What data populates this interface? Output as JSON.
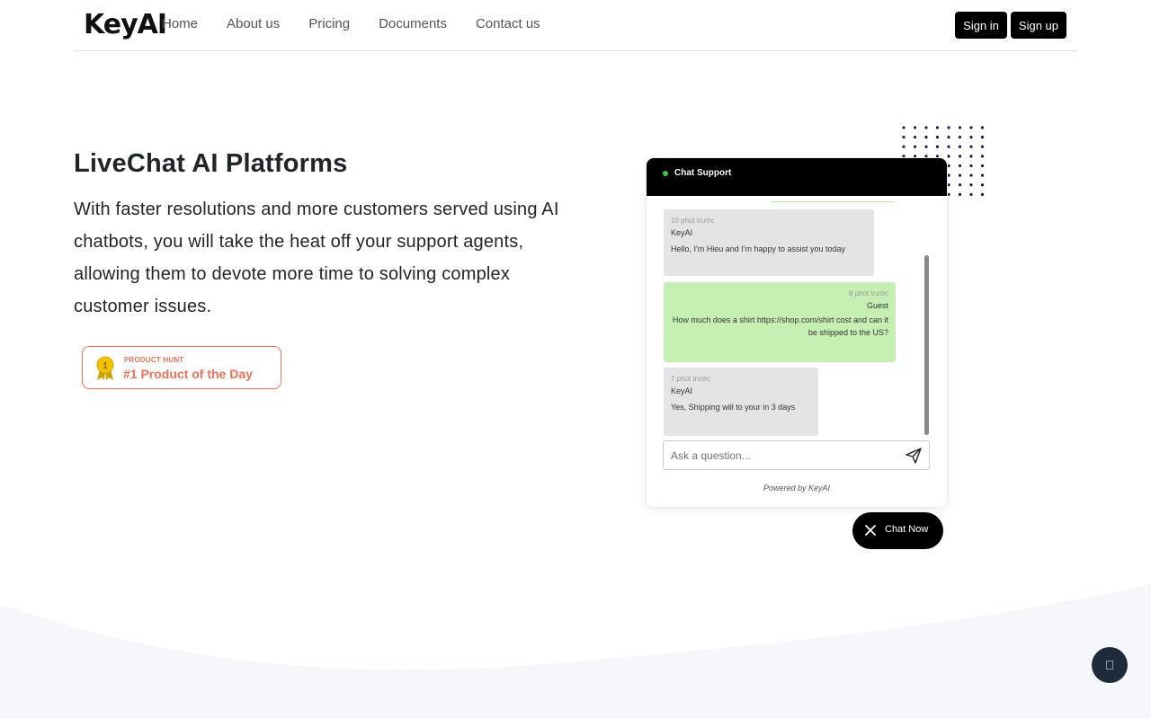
{
  "nav": {
    "logo": "KeyAI",
    "links": [
      "Home",
      "About us",
      "Pricing",
      "Documents",
      "Contact us"
    ],
    "sign_in": "Sign in",
    "sign_up": "Sign up"
  },
  "hero": {
    "title": "LiveChat AI Platforms",
    "description": "With faster resolutions and more customers served using AI chatbots, you will take the heat off your support agents, allowing them to devote more time to solving complex customer issues."
  },
  "product_hunt": {
    "rank": "1",
    "label": "PRODUCT HUNT",
    "title": "#1 Product of the Day"
  },
  "chat_widget": {
    "header_title": "Chat Support",
    "messages": [
      {
        "time": "10 phút trước",
        "sender": "KeyAI",
        "text": "Hello, I'm Hieu and I'm happy to assist you today",
        "role": "bot"
      },
      {
        "time": "8 phút trước",
        "sender": "Guest",
        "text": "How much does a shirt https://shop.com/shirt cost and can it be shipped to the US?",
        "role": "guest"
      },
      {
        "time": "7 phút trước",
        "sender": "KeyAI",
        "text": "Yes, Shipping will to your in 3 days",
        "role": "bot"
      }
    ],
    "input_placeholder": "Ask a question...",
    "powered_by": "Powered by KeyAI",
    "chat_now_label": "Chat Now"
  },
  "colors": {
    "accent_dark": "#000000",
    "product_hunt": "#e8735a",
    "guest_bubble": "#c6efb3",
    "bot_bubble": "#e4e4e4",
    "online": "#2ecc40",
    "dots": "#1a1d4a",
    "scroll_button": "#1f2a3a"
  },
  "icons": [
    "medal-icon",
    "send-icon",
    "close-icon",
    "arrow-up-icon"
  ]
}
